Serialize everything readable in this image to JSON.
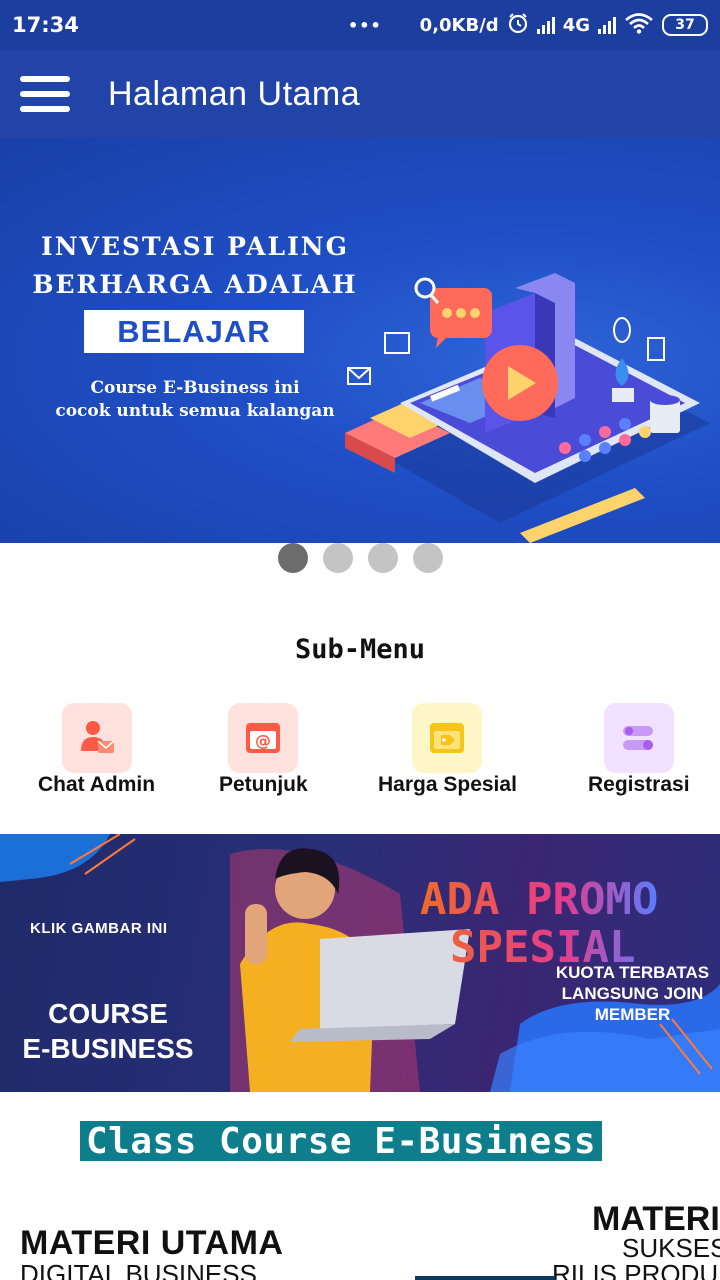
{
  "status_bar": {
    "time": "17:34",
    "dots": "•••",
    "speed": "0,0KB/d",
    "network": "4G",
    "battery": "37"
  },
  "app_bar": {
    "title": "Halaman Utama"
  },
  "hero": {
    "line1": "INVESTASI PALING",
    "line2": "BERHARGA ADALAH",
    "highlight": "BELAJAR",
    "sub1": "Course E-Business ini",
    "sub2": "cocok untuk semua kalangan"
  },
  "carousel": {
    "count": 4,
    "active_index": 0
  },
  "submenu": {
    "title": "Sub-Menu",
    "items": [
      {
        "label": "Chat Admin",
        "icon": "chat-admin-icon",
        "color": "#ff6a55"
      },
      {
        "label": "Petunjuk",
        "icon": "email-at-icon",
        "color": "#ff6a55"
      },
      {
        "label": "Harga Spesial",
        "icon": "price-tag-icon",
        "color": "#f5c518"
      },
      {
        "label": "Registrasi",
        "icon": "toggle-list-icon",
        "color": "#b36df0"
      }
    ]
  },
  "promo": {
    "klik": "KLIK GAMBAR INI",
    "course_line1": "COURSE",
    "course_line2": "E-BUSINESS",
    "ada_line1": "ADA PROMO",
    "ada_line2": "SPESIAL",
    "kuota_line1": "KUOTA TERBATAS",
    "kuota_line2": "LANGSUNG JOIN",
    "kuota_line3": "MEMBER"
  },
  "class_section": {
    "title": "Class Course E-Business",
    "cards": [
      {
        "title": "MATERI UTAMA",
        "subtitle": "DIGITAL BUSINESS"
      },
      {
        "title": "MATERI",
        "subtitle1": "SUKSES",
        "subtitle2": "RILIS PRODUK"
      }
    ]
  }
}
